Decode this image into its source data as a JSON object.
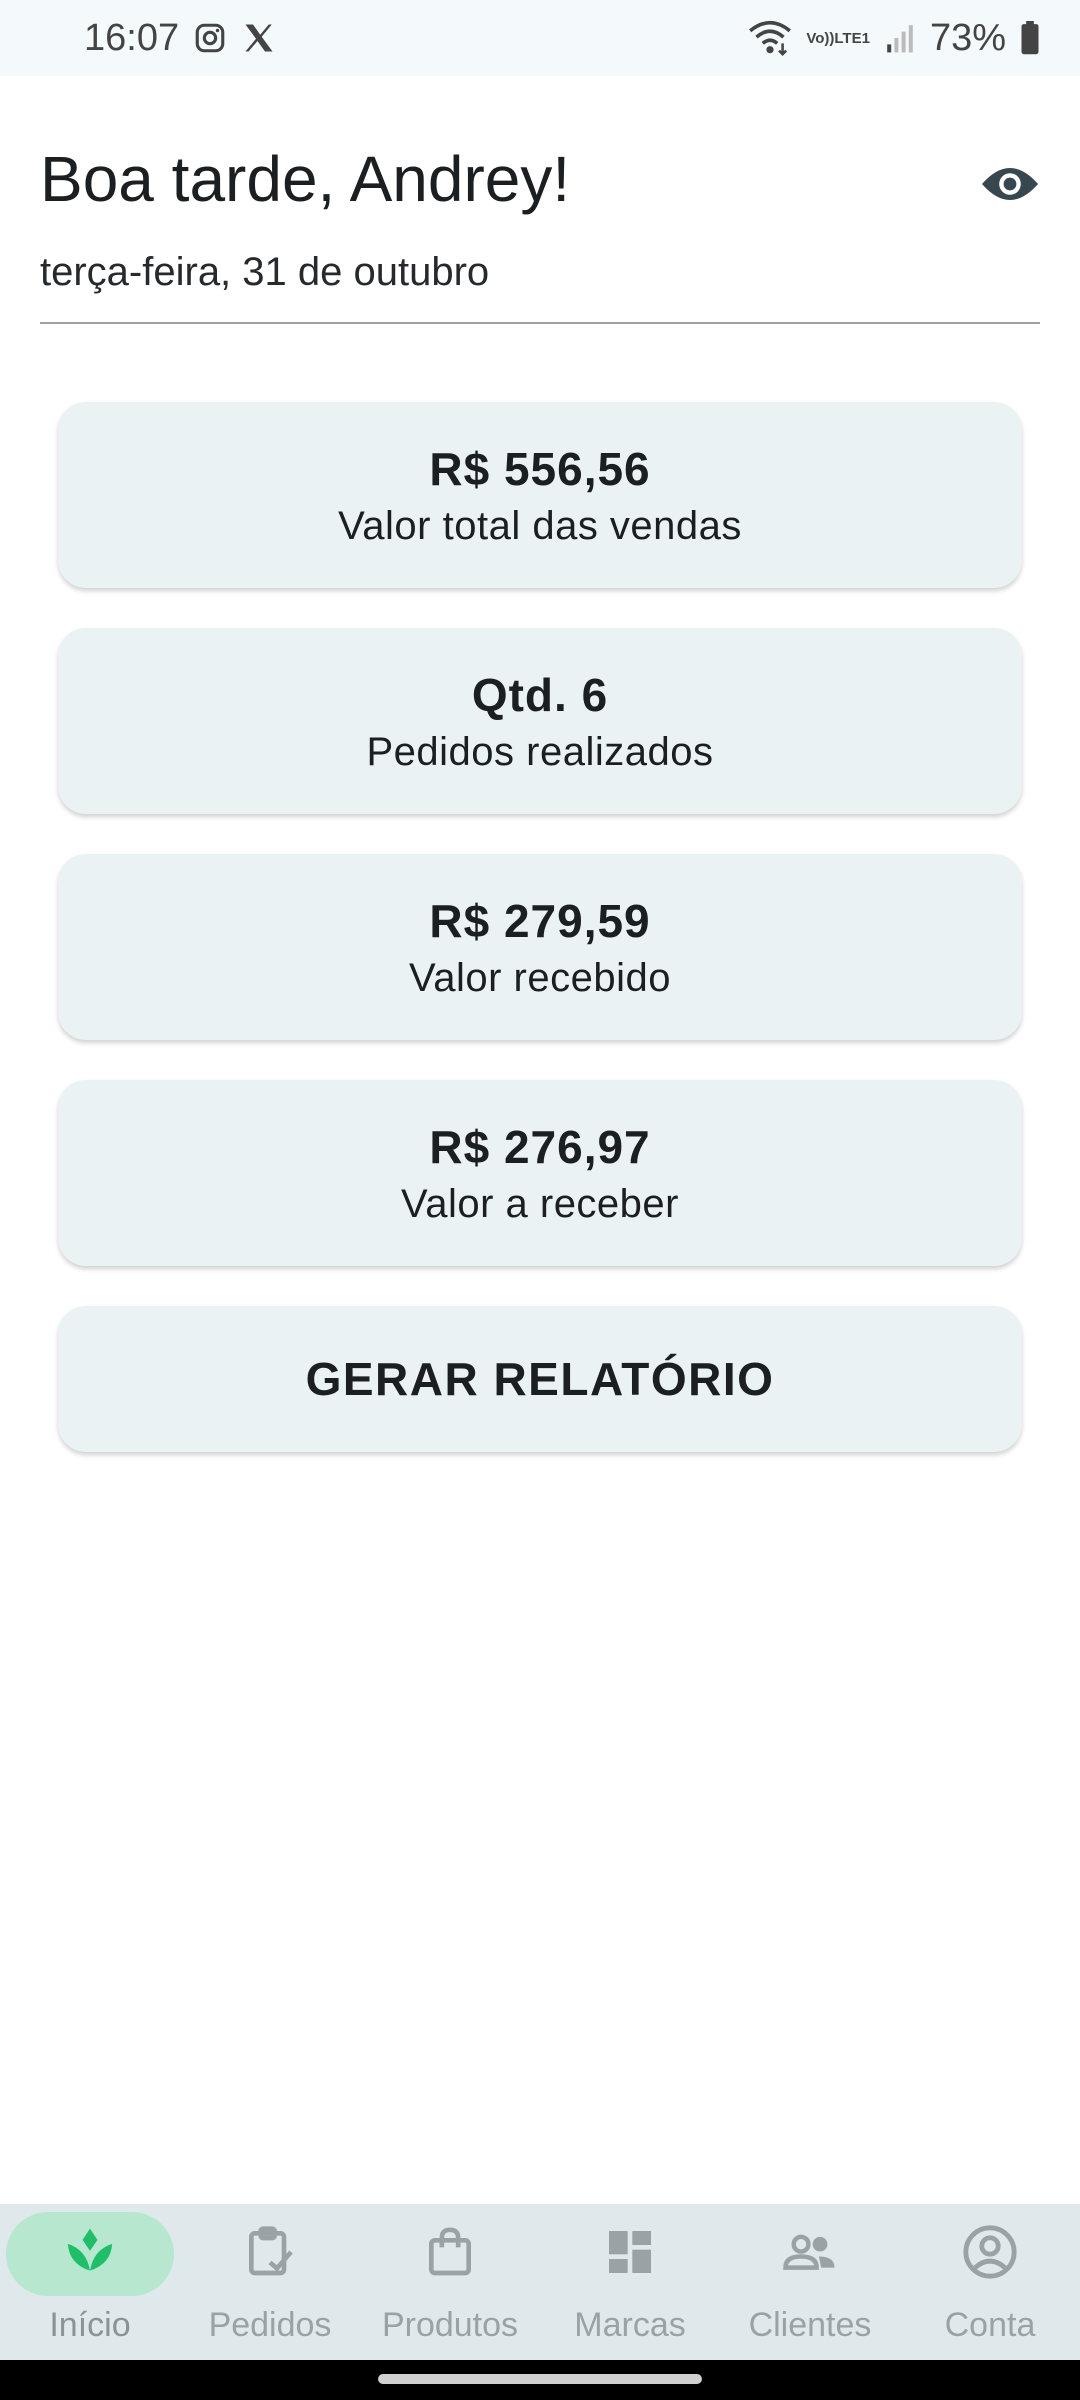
{
  "status_bar": {
    "time": "16:07",
    "battery": "73%",
    "network_label_top": "Vo))",
    "network_label_bottom": "LTE1"
  },
  "header": {
    "greeting": "Boa tarde, Andrey!",
    "date": "terça-feira, 31 de outubro",
    "visibility_icon": "eye-icon"
  },
  "cards": [
    {
      "value": "R$ 556,56",
      "label": "Valor total das vendas"
    },
    {
      "value": "Qtd. 6",
      "label": "Pedidos realizados"
    },
    {
      "value": "R$ 279,59",
      "label": "Valor recebido"
    },
    {
      "value": "R$ 276,97",
      "label": "Valor a receber"
    }
  ],
  "report_button": {
    "label": "GERAR RELATÓRIO"
  },
  "bottom_nav": {
    "active_color": "#1fbf6a",
    "active_bg": "#b8e7cf",
    "items": [
      {
        "label": "Início",
        "icon": "sprout-icon",
        "active": true
      },
      {
        "label": "Pedidos",
        "icon": "clipboard-check-icon",
        "active": false
      },
      {
        "label": "Produtos",
        "icon": "shopping-bag-icon",
        "active": false
      },
      {
        "label": "Marcas",
        "icon": "dashboard-grid-icon",
        "active": false
      },
      {
        "label": "Clientes",
        "icon": "people-icon",
        "active": false
      },
      {
        "label": "Conta",
        "icon": "account-circle-icon",
        "active": false
      }
    ]
  }
}
